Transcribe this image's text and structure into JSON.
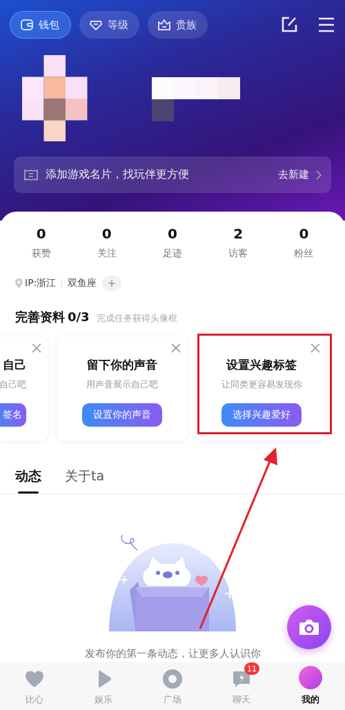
{
  "header": {
    "pills": [
      {
        "label": "钱包",
        "kind": "wallet",
        "selected": true
      },
      {
        "label": "等级",
        "kind": "gem",
        "selected": false
      },
      {
        "label": "贵族",
        "kind": "crown",
        "selected": false
      }
    ]
  },
  "game_banner": {
    "text": "添加游戏名片，找玩伴更方便",
    "action": "去新建"
  },
  "stats": [
    {
      "value": "0",
      "label": "获赞"
    },
    {
      "value": "0",
      "label": "关注"
    },
    {
      "value": "0",
      "label": "足迹"
    },
    {
      "value": "2",
      "label": "访客"
    },
    {
      "value": "0",
      "label": "粉丝"
    }
  ],
  "tags": {
    "location": "IP:浙江",
    "items": [
      "双鱼座"
    ]
  },
  "tasks": {
    "title": "完善资料",
    "progress": "0/3",
    "hint": "完成任务获得头像框",
    "cards": [
      {
        "title": "自己",
        "subtitle": "自己吧",
        "button": "签名",
        "kind": "partial",
        "highlighted": false
      },
      {
        "title": "留下你的声音",
        "subtitle": "用声音展示自己吧",
        "button": "设置你的声音",
        "kind": "full",
        "highlighted": false
      },
      {
        "title": "设置兴趣标签",
        "subtitle": "让同类更容易发现你",
        "button": "选择兴趣爱好",
        "kind": "full",
        "highlighted": true
      }
    ]
  },
  "tabs": [
    {
      "label": "动态",
      "selected": true
    },
    {
      "label": "关于ta",
      "selected": false
    }
  ],
  "empty_state": {
    "text": "发布你的第一条动态，让更多人认识你"
  },
  "nav": [
    {
      "label": "比心",
      "kind": "heart",
      "selected": false
    },
    {
      "label": "娱乐",
      "kind": "play",
      "selected": false
    },
    {
      "label": "广场",
      "kind": "ring",
      "selected": false
    },
    {
      "label": "聊天",
      "kind": "chat",
      "badge": "11",
      "selected": false
    },
    {
      "label": "我的",
      "kind": "avatar",
      "selected": true
    }
  ]
}
